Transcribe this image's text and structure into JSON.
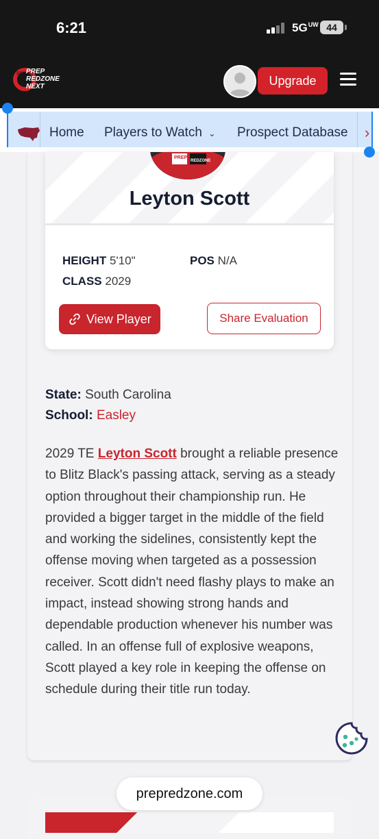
{
  "status_bar": {
    "time": "6:21",
    "network": "5G",
    "network_sup": "UW",
    "battery": "44"
  },
  "header": {
    "logo_alt": "PREP REDZONE NEXT",
    "upgrade_label": "Upgrade"
  },
  "nav": {
    "items": [
      {
        "label": "Home"
      },
      {
        "label": "Players to Watch",
        "has_dropdown": true
      },
      {
        "label": "Prospect Database"
      }
    ]
  },
  "player_card": {
    "name": "Leyton Scott",
    "height_label": "HEIGHT",
    "height_value": "5'10\"",
    "pos_label": "POS",
    "pos_value": "N/A",
    "class_label": "CLASS",
    "class_value": "2029",
    "view_button": "View Player",
    "share_button": "Share Evaluation"
  },
  "meta": {
    "state_label": "State:",
    "state_value": "South Carolina",
    "school_label": "School:",
    "school_value": "Easley"
  },
  "article": {
    "prefix": "2029 TE ",
    "link_text": "Leyton Scott",
    "body": " brought a reliable presence to Blitz Black's passing attack, serving as a steady option throughout their championship run. He provided a bigger target in the middle of the field and working the sidelines, consistently kept the offense moving when targeted as a possession receiver. Scott didn't need flashy plays to make an impact, instead showing strong hands and dependable production whenever his number was called. In an offense full of explosive weapons, Scott played a key role in keeping the offense on schedule during their title run today."
  },
  "browser": {
    "url": "prepredzone.com"
  },
  "colors": {
    "brand_red": "#c8252d",
    "nav_bg": "#d3e6fb",
    "header_bg": "#161616"
  }
}
